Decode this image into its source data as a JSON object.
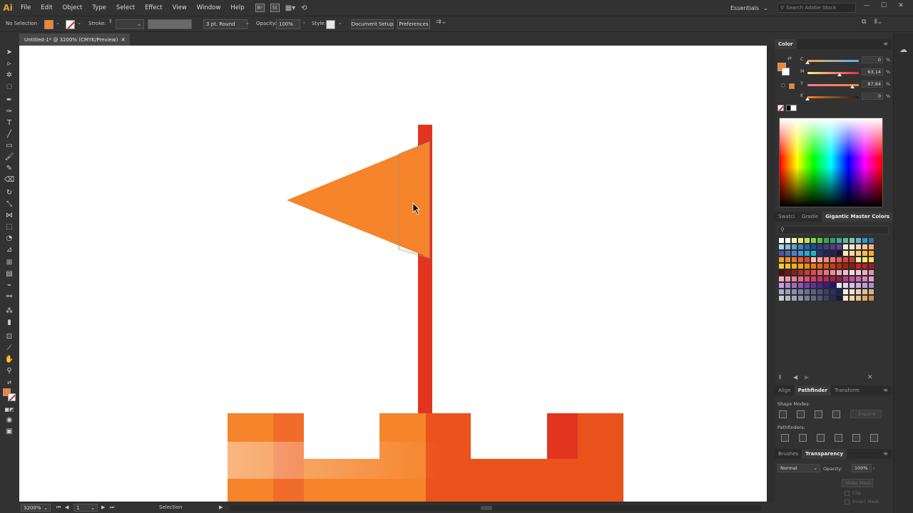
{
  "app": {
    "logo": "Ai"
  },
  "menu": [
    "File",
    "Edit",
    "Object",
    "Type",
    "Select",
    "Effect",
    "View",
    "Window",
    "Help"
  ],
  "menu_icons": {
    "bridge": "Br",
    "stock": "St"
  },
  "workspace": {
    "label": "Essentials",
    "search_placeholder": "Search Adobe Stock"
  },
  "control_bar": {
    "selection_label": "No Selection",
    "stroke_label": "Stroke:",
    "profile": "3 pt. Round",
    "opacity_label": "Opacity:",
    "opacity_value": "100%",
    "style_label": "Style:",
    "document_setup": "Document Setup",
    "preferences": "Preferences"
  },
  "document": {
    "tab_title": "Untitled-1* @ 3200% (CMYK/Preview)",
    "close": "×"
  },
  "status_bar": {
    "zoom": "3200%",
    "artboard": "1",
    "tool": "Selection"
  },
  "color_panel": {
    "title": "Color",
    "sliders": [
      {
        "label": "C",
        "value": "0",
        "fraction": 0.0,
        "gradient": "linear-gradient(to right,#f5a85a,#5ab4e6)"
      },
      {
        "label": "M",
        "value": "63,14",
        "fraction": 0.63,
        "gradient": "linear-gradient(to right,#fff07a,#ea2a4a)"
      },
      {
        "label": "Y",
        "value": "87,84",
        "fraction": 0.88,
        "gradient": "linear-gradient(to right,#f07aa0,#f5842a)"
      },
      {
        "label": "K",
        "value": "0",
        "fraction": 0.0,
        "gradient": "linear-gradient(to right,#f5842a,#2a1a10)"
      }
    ],
    "unit": "%"
  },
  "swatch_panel": {
    "tabs": [
      "Swatcl",
      "Gradie",
      "Gigantic Master Colors"
    ],
    "active_tab": "Gigantic Master Colors",
    "swatches": [
      "#ffffff",
      "#ffffff",
      "#f6f0b8",
      "#e8e86a",
      "#c6dc58",
      "#8cc850",
      "#62b94a",
      "#3aa648",
      "#2e9c70",
      "#40a890",
      "#64b4a0",
      "#8cc4b0",
      "#60b4c8",
      "#3c94b8",
      "#2a78a8",
      "#b4d4ec",
      "#88bce0",
      "#5ca0d6",
      "#3a84c8",
      "#2864b0",
      "#1a4c9c",
      "#2a3c8c",
      "#3c3c8c",
      "#503c90",
      "#683c98",
      "#f0ece4",
      "#f8e4d0",
      "#f8d4b4",
      "#f6c494",
      "#f4b078",
      "#4458a8",
      "#4a68b8",
      "#5080c8",
      "#3898d8",
      "#20acdc",
      "#1cb4d0",
      "#2a3070",
      "#1c2460",
      "#202050",
      "#141438",
      "#fce8c0",
      "#fcd898",
      "#fcc874",
      "#fcb850",
      "#fca83c",
      "#f4a020",
      "#f4882a",
      "#ee7030",
      "#e85a34",
      "#e04436",
      "#f8b8b8",
      "#f4a0a0",
      "#f08888",
      "#ec7070",
      "#e85858",
      "#e04444",
      "#d83434",
      "#fcf4a0",
      "#fce870",
      "#fcdc50",
      "#f8d038",
      "#f4c020",
      "#f0b010",
      "#f8a018",
      "#f48c10",
      "#f07808",
      "#ec6408",
      "#e85008",
      "#d03c08",
      "#c02c08",
      "#a82008",
      "#901808",
      "#d81c1c",
      "#c41a2a",
      "#a8142a",
      "#500c0c",
      "#701414",
      "#902020",
      "#b02c2c",
      "#d03838",
      "#e84848",
      "#e85c6c",
      "#e87484",
      "#ec8c9c",
      "#f0a4b4",
      "#f4bccc",
      "#f8d4e0",
      "#f0c8d4",
      "#e4b0c4",
      "#d898b0",
      "#f4b0b8",
      "#f098a8",
      "#ec8098",
      "#e46888",
      "#dc5078",
      "#d43c6c",
      "#c83064",
      "#b82858",
      "#a8204c",
      "#902040",
      "#b43c8c",
      "#c4509c",
      "#d068ac",
      "#dc80bc",
      "#e898cc",
      "#c8a0d8",
      "#b488cc",
      "#a070c0",
      "#8c58b4",
      "#7840a8",
      "#64309c",
      "#502490",
      "#3c1884",
      "#2c1070",
      "#f0e4f8",
      "#e4d0f0",
      "#d8bce8",
      "#ccace0",
      "#c09cd8",
      "#b48cd0",
      "#a8b0c8",
      "#98a0bc",
      "#8890b0",
      "#7880a4",
      "#687098",
      "#58608c",
      "#485080",
      "#384074",
      "#283068",
      "#1c2058",
      "#f8f0e8",
      "#f0e0d0",
      "#e8d0b8",
      "#e0c0a0",
      "#d8b088",
      "#c8ccd4",
      "#b4b8c4",
      "#a0a4b4",
      "#8c90a4",
      "#787c94",
      "#646884",
      "#505474",
      "#3c4064",
      "#282c54",
      "#141844",
      "#fce8c8",
      "#f4d4a8",
      "#e8c088",
      "#d8a868",
      "#c89050"
    ]
  },
  "bottom_tabs": {
    "align": "Align",
    "pathfinder": "Pathfinder",
    "transform": "Transform",
    "shape_modes": "Shape Modes:",
    "pathfinders": "Pathfinders:",
    "expand": "Expand",
    "brushes": "Brushes",
    "transparency": "Transparency",
    "blend_mode": "Normal",
    "opacity_label": "Opacity:",
    "opacity_value": "100%",
    "make_mask": "Make Mask",
    "clip": "Clip",
    "invert_mask": "Invert Mask"
  },
  "colors": {
    "flag": "#f5842a",
    "pole": "#e3341f",
    "tower_orange": "#f5842a",
    "tower_mid": "#f06c2a",
    "tower_dark": "#eb531c",
    "accent": "#e8a31b"
  }
}
